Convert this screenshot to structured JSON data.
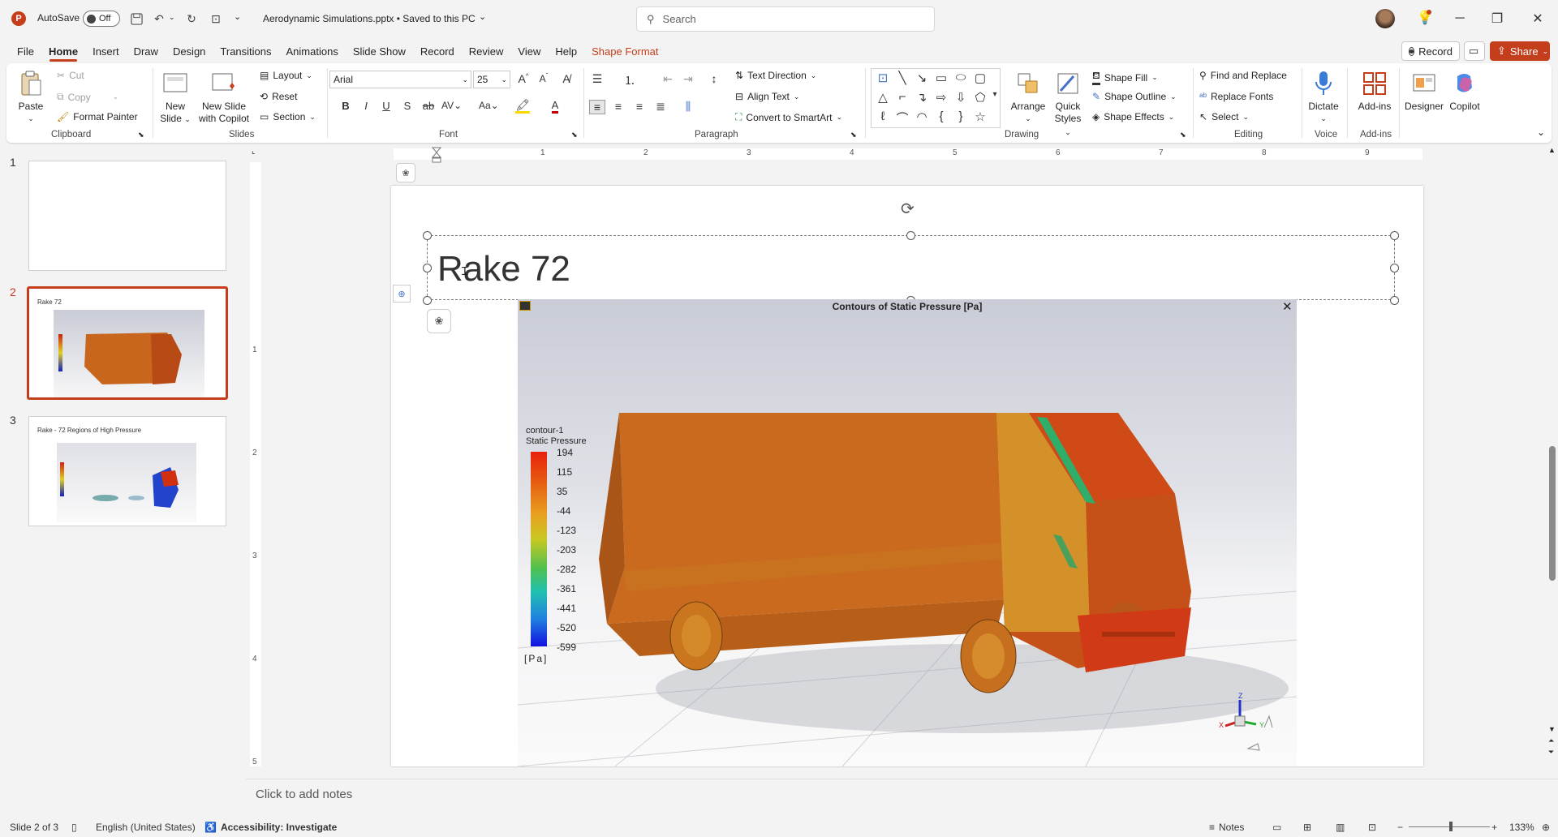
{
  "titlebar": {
    "autosave_label": "AutoSave",
    "autosave_state": "Off",
    "doc_title": "Aerodynamic Simulations.pptx • Saved to this PC",
    "search_placeholder": "Search"
  },
  "tabs": [
    "File",
    "Home",
    "Insert",
    "Draw",
    "Design",
    "Transitions",
    "Animations",
    "Slide Show",
    "Record",
    "Review",
    "View",
    "Help"
  ],
  "context_tab": "Shape Format",
  "record_btn": "Record",
  "share_btn": "Share",
  "ribbon": {
    "clipboard": {
      "paste": "Paste",
      "cut": "Cut",
      "copy": "Copy",
      "format_painter": "Format Painter",
      "label": "Clipboard"
    },
    "slides": {
      "new_slide_1": "New",
      "new_slide_2": "Slide",
      "new_copilot_1": "New Slide",
      "new_copilot_2": "with Copilot",
      "layout": "Layout",
      "reset": "Reset",
      "section": "Section",
      "label": "Slides"
    },
    "font": {
      "name": "Arial",
      "size": "25",
      "label": "Font"
    },
    "paragraph": {
      "text_direction": "Text Direction",
      "align_text": "Align Text",
      "convert_smartart": "Convert to SmartArt",
      "label": "Paragraph"
    },
    "drawing": {
      "arrange": "Arrange",
      "quick_styles_1": "Quick",
      "quick_styles_2": "Styles",
      "shape_fill": "Shape Fill",
      "shape_outline": "Shape Outline",
      "shape_effects": "Shape Effects",
      "label": "Drawing"
    },
    "editing": {
      "find_replace": "Find and Replace",
      "replace_fonts": "Replace Fonts",
      "select": "Select",
      "label": "Editing"
    },
    "voice": {
      "dictate": "Dictate",
      "label": "Voice"
    },
    "addins": {
      "addins": "Add-ins",
      "label": "Add-ins"
    },
    "designer": "Designer",
    "copilot": "Copilot"
  },
  "thumbnails": [
    {
      "num": "1",
      "title": ""
    },
    {
      "num": "2",
      "title": "Rake 72"
    },
    {
      "num": "3",
      "title": "Rake - 72 Regions of High Pressure"
    }
  ],
  "ruler_h": [
    "1",
    "2",
    "3",
    "4",
    "5",
    "6",
    "7",
    "8",
    "9"
  ],
  "ruler_v": [
    "1",
    "2",
    "3",
    "4",
    "5"
  ],
  "slide": {
    "title": "Rake 72",
    "image_title": "Contours of Static Pressure [Pa]",
    "legend_title_1": "contour-1",
    "legend_title_2": "Static Pressure",
    "legend_values": [
      "194",
      "115",
      "35",
      "-44",
      "-123",
      "-203",
      "-282",
      "-361",
      "-441",
      "-520",
      "-599"
    ],
    "legend_unit": "[Pa]",
    "axis_labels": {
      "z": "Z",
      "x": "X",
      "y": "Y"
    }
  },
  "notes_placeholder": "Click to add notes",
  "status": {
    "slide_info": "Slide 2 of 3",
    "language": "English (United States)",
    "accessibility": "Accessibility: Investigate",
    "notes": "Notes",
    "zoom": "133%"
  },
  "colors": {
    "accent": "#c43e1c",
    "truck": "#c8661e"
  }
}
